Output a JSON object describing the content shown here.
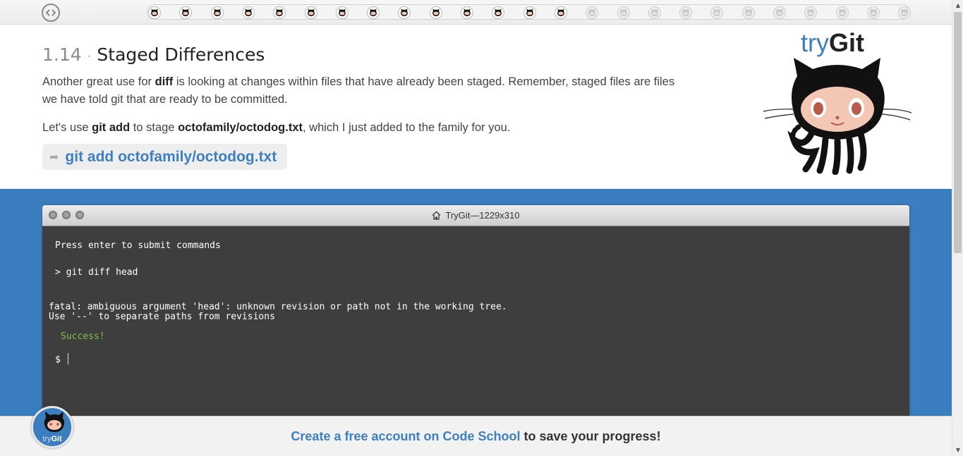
{
  "progress": {
    "completed": 14,
    "total": 25
  },
  "lesson": {
    "number": "1.14",
    "separator": "·",
    "title": "Staged Differences",
    "para1": {
      "t1": "Another great use for ",
      "b1": "diff",
      "t2": " is looking at changes within files that have already been staged. Remember, staged files are files we have told git that are ready to be committed."
    },
    "para2": {
      "t1": "Let's use ",
      "b1": "git add",
      "t2": " to stage ",
      "b2": "octofamily/octodog.txt",
      "t3": ", which I just added to the family for you."
    },
    "command": "git add octofamily/octodog.txt"
  },
  "logo": {
    "try": "try",
    "git": "Git"
  },
  "terminal": {
    "title": "TryGit—1229x310",
    "lines": {
      "hint": "Press enter to submit commands",
      "command": "> git diff head",
      "error1": "fatal: ambiguous argument 'head': unknown revision or path not in the working tree.",
      "error2": "Use '--' to separate paths from revisions",
      "success": "Success!",
      "prompt": "$"
    }
  },
  "savebar": {
    "link": "Create a free account on Code School",
    "rest": " to save your progress!"
  },
  "badge": {
    "try": "try",
    "git": "Git"
  },
  "colors": {
    "accent": "#3d7fc1",
    "band": "#3b7ec0",
    "terminal_bg": "#3e3e3e",
    "success": "#7dc24b"
  }
}
